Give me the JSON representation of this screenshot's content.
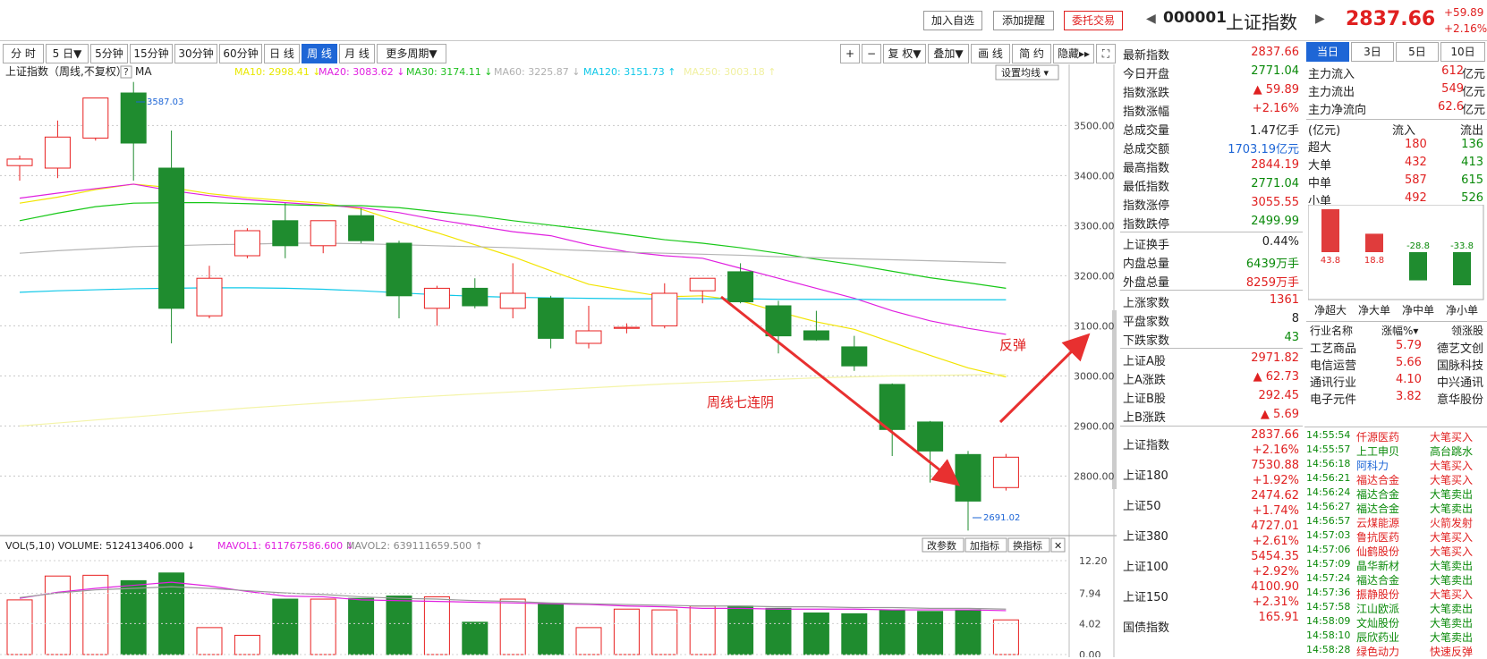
{
  "header": {
    "buttons": [
      "加入自选",
      "添加提醒",
      "委托交易"
    ],
    "code": "000001",
    "name": "上证指数",
    "price": "2837.66",
    "change": "+59.89",
    "change_pct": "+2.16%"
  },
  "periods": [
    "分 时",
    "5 日▼",
    "5分钟",
    "15分钟",
    "30分钟",
    "60分钟",
    "日 线",
    "周 线",
    "月 线",
    "更多周期▼"
  ],
  "tools": [
    "+",
    "−",
    "复 权▼",
    "叠加▼",
    "画 线",
    "简 约",
    "隐藏▸▸",
    "⛶"
  ],
  "chart": {
    "title": "上证指数（周线,不复权）",
    "q": "?",
    "ma_label": "MA",
    "ma_items": [
      {
        "text": "MA10: 2998.41 ↓",
        "color": "#e8e800"
      },
      {
        "text": "MA20: 3083.62 ↓",
        "color": "#e020e0"
      },
      {
        "text": "MA30: 3174.11 ↓",
        "color": "#20c020"
      },
      {
        "text": "MA60: 3225.87 ↓",
        "color": "#b0b0b0"
      },
      {
        "text": "MA120: 3151.73 ↑",
        "color": "#10c8e8"
      },
      {
        "text": "MA250: 3003.18 ↑",
        "color": "#f0f0a0"
      }
    ],
    "set_ma": "设置均线 ▾",
    "ytick_labels": [
      "3500.00",
      "3400.00",
      "3300.00",
      "3200.00",
      "3100.00",
      "3000.00",
      "2900.00",
      "2800.00"
    ],
    "high_label": "3587.03",
    "low_label": "2691.02",
    "annot1": "周线七连阴",
    "annot2": "反弹",
    "vol_title": "VOL(5,10)  VOLUME: 512413406.000 ↓",
    "vol_m1": "MAVOL1: 611767586.600 ↓",
    "vol_m2": "MAVOL2: 639111659.500 ↑",
    "vol_buttons": [
      "改参数",
      "加指标",
      "换指标",
      "✕"
    ],
    "vol_ticks": [
      "12.20",
      "7.94",
      "4.02",
      "0.00"
    ]
  },
  "chart_data": {
    "type": "candlestick",
    "ylim": [
      2690,
      3590
    ],
    "candles": [
      {
        "o": 3420,
        "h": 3440,
        "l": 3390,
        "c": 3433
      },
      {
        "o": 3415,
        "h": 3510,
        "l": 3395,
        "c": 3477
      },
      {
        "o": 3475,
        "h": 3550,
        "l": 3470,
        "c": 3555
      },
      {
        "o": 3565,
        "h": 3587.03,
        "l": 3390,
        "c": 3465
      },
      {
        "o": 3415,
        "h": 3490,
        "l": 3065,
        "c": 3135
      },
      {
        "o": 3120,
        "h": 3220,
        "l": 3115,
        "c": 3195
      },
      {
        "o": 3240,
        "h": 3295,
        "l": 3235,
        "c": 3290
      },
      {
        "o": 3310,
        "h": 3345,
        "l": 3235,
        "c": 3260
      },
      {
        "o": 3260,
        "h": 3310,
        "l": 3245,
        "c": 3310
      },
      {
        "o": 3320,
        "h": 3335,
        "l": 3265,
        "c": 3270
      },
      {
        "o": 3265,
        "h": 3270,
        "l": 3115,
        "c": 3160
      },
      {
        "o": 3135,
        "h": 3180,
        "l": 3100,
        "c": 3175
      },
      {
        "o": 3175,
        "h": 3195,
        "l": 3135,
        "c": 3140
      },
      {
        "o": 3135,
        "h": 3225,
        "l": 3115,
        "c": 3165
      },
      {
        "o": 3155,
        "h": 3160,
        "l": 3055,
        "c": 3075
      },
      {
        "o": 3065,
        "h": 3140,
        "l": 3055,
        "c": 3090
      },
      {
        "o": 3095,
        "h": 3105,
        "l": 3085,
        "c": 3097
      },
      {
        "o": 3100,
        "h": 3185,
        "l": 3095,
        "c": 3165
      },
      {
        "o": 3170,
        "h": 3190,
        "l": 3145,
        "c": 3195
      },
      {
        "o": 3208,
        "h": 3225,
        "l": 3145,
        "c": 3148
      },
      {
        "o": 3140,
        "h": 3150,
        "l": 3045,
        "c": 3080
      },
      {
        "o": 3090,
        "h": 3130,
        "l": 3070,
        "c": 3072
      },
      {
        "o": 3058,
        "h": 3080,
        "l": 3010,
        "c": 3020
      },
      {
        "o": 2983,
        "h": 2985,
        "l": 2840,
        "c": 2893
      },
      {
        "o": 2908,
        "h": 2910,
        "l": 2787,
        "c": 2850
      },
      {
        "o": 2843,
        "h": 2850,
        "l": 2691.02,
        "c": 2750
      },
      {
        "o": 2777,
        "h": 2844.19,
        "l": 2771.04,
        "c": 2837.66
      }
    ],
    "ma_series": [
      {
        "name": "MA10",
        "color": "#f2e400",
        "values": [
          3345,
          3357,
          3372,
          3383,
          3376,
          3364,
          3356,
          3350,
          3345,
          3333,
          3308,
          3286,
          3262,
          3238,
          3210,
          3183,
          3170,
          3158,
          3160,
          3150,
          3128,
          3108,
          3093,
          3067,
          3041,
          3016,
          2998
        ]
      },
      {
        "name": "MA20",
        "color": "#e020e0",
        "values": [
          3355,
          3365,
          3374,
          3383,
          3370,
          3360,
          3352,
          3346,
          3341,
          3336,
          3326,
          3312,
          3300,
          3288,
          3280,
          3262,
          3248,
          3240,
          3235,
          3215,
          3195,
          3175,
          3155,
          3130,
          3110,
          3095,
          3083
        ]
      },
      {
        "name": "MA30",
        "color": "#18c818",
        "values": [
          3310,
          3325,
          3338,
          3345,
          3346,
          3346,
          3344,
          3342,
          3340,
          3340,
          3336,
          3328,
          3320,
          3310,
          3301,
          3292,
          3282,
          3272,
          3265,
          3256,
          3245,
          3233,
          3222,
          3209,
          3196,
          3186,
          3175
        ]
      },
      {
        "name": "MA60",
        "color": "#b4b4b4",
        "values": [
          3245,
          3250,
          3254,
          3258,
          3260,
          3262,
          3263,
          3265,
          3265,
          3264,
          3262,
          3260,
          3258,
          3256,
          3253,
          3250,
          3247,
          3245,
          3243,
          3241,
          3238,
          3236,
          3234,
          3232,
          3230,
          3228,
          3226
        ]
      },
      {
        "name": "MA120",
        "color": "#10c8e8",
        "values": [
          3167,
          3170,
          3172,
          3174,
          3175,
          3176,
          3176,
          3175,
          3173,
          3170,
          3166,
          3162,
          3159,
          3157,
          3156,
          3155,
          3154,
          3154,
          3154,
          3154,
          3153,
          3153,
          3153,
          3152,
          3152,
          3152,
          3152
        ]
      },
      {
        "name": "MA250",
        "color": "#f4f4a8",
        "values": [
          2900,
          2906,
          2912,
          2918,
          2924,
          2930,
          2936,
          2941,
          2946,
          2951,
          2956,
          2960,
          2964,
          2968,
          2972,
          2976,
          2980,
          2984,
          2987,
          2990,
          2993,
          2996,
          2998,
          3000,
          3001,
          3002,
          3003
        ]
      }
    ],
    "volume": {
      "max": 12.2,
      "values": [
        7.1,
        10.2,
        10.3,
        9.6,
        10.6,
        3.5,
        2.5,
        7.2,
        7.2,
        7.3,
        7.6,
        7.5,
        4.2,
        7.2,
        6.6,
        3.5,
        5.9,
        5.8,
        6.3,
        6.3,
        6.0,
        5.4,
        5.3,
        5.8,
        5.6,
        5.8,
        4.5
      ],
      "mavol1": [
        7.3,
        8.1,
        8.6,
        9.0,
        9.4,
        8.9,
        8.2,
        7.6,
        7.5,
        7.1,
        7.0,
        6.9,
        6.8,
        6.7,
        6.6,
        6.5,
        6.3,
        6.2,
        6.0,
        6.0,
        5.9,
        5.9,
        5.9,
        5.8,
        5.8,
        5.8,
        5.7
      ],
      "mavol2": [
        7.4,
        8.0,
        8.4,
        8.6,
        8.8,
        8.6,
        8.3,
        8.0,
        7.8,
        7.5,
        7.3,
        7.2,
        7.0,
        6.9,
        6.7,
        6.6,
        6.5,
        6.4,
        6.3,
        6.3,
        6.2,
        6.2,
        6.1,
        6.1,
        6.0,
        6.0,
        5.9
      ]
    }
  },
  "quote_rows": [
    {
      "l": "最新指数",
      "v": "2837.66",
      "c": "red"
    },
    {
      "l": "今日开盘",
      "v": "2771.04",
      "c": "green"
    },
    {
      "l": "指数涨跌",
      "v": "▲ 59.89",
      "c": "red"
    },
    {
      "l": "指数涨幅",
      "v": "+2.16%",
      "c": "red"
    },
    {
      "l": "总成交量",
      "v": "1.47亿手",
      "c": "dark"
    },
    {
      "l": "总成交额",
      "v": "1703.19亿元",
      "c": "blue"
    },
    {
      "l": "最高指数",
      "v": "2844.19",
      "c": "red"
    },
    {
      "l": "最低指数",
      "v": "2771.04",
      "c": "green"
    },
    {
      "l": "指数涨停",
      "v": "3055.55",
      "c": "red"
    },
    {
      "l": "指数跌停",
      "v": "2499.99",
      "c": "green"
    },
    {
      "l": "上证换手",
      "v": "0.44%",
      "c": "dark"
    },
    {
      "l": "内盘总量",
      "v": "6439万手",
      "c": "green"
    },
    {
      "l": "外盘总量",
      "v": "8259万手",
      "c": "red"
    },
    {
      "l": "上涨家数",
      "v": "1361",
      "c": "red"
    },
    {
      "l": "平盘家数",
      "v": "8",
      "c": "dark"
    },
    {
      "l": "下跌家数",
      "v": "43",
      "c": "green"
    },
    {
      "l": "上证A股",
      "v": "2971.82",
      "c": "red"
    },
    {
      "l": "上A涨跌",
      "v": "▲ 62.73",
      "c": "red"
    },
    {
      "l": "上证B股",
      "v": "292.45",
      "c": "red"
    },
    {
      "l": "上B涨跌",
      "v": "▲ 5.69",
      "c": "red"
    }
  ],
  "indices": [
    {
      "name": "上证指数",
      "v": "2837.66",
      "p": "+2.16%"
    },
    {
      "name": "上证180",
      "v": "7530.88",
      "p": "+1.92%"
    },
    {
      "name": "上证50",
      "v": "2474.62",
      "p": "+1.74%"
    },
    {
      "name": "上证380",
      "v": "4727.01",
      "p": "+2.61%"
    },
    {
      "name": "上证100",
      "v": "5454.35",
      "p": "+2.92%"
    },
    {
      "name": "上证150",
      "v": "4100.90",
      "p": "+2.31%"
    },
    {
      "name": "国债指数",
      "v": "165.91",
      "p": ""
    }
  ],
  "flow": {
    "tabs": [
      "当日",
      "3日",
      "5日",
      "10日"
    ],
    "main": [
      {
        "l": "主力流入",
        "v": "612",
        "u": "亿元"
      },
      {
        "l": "主力流出",
        "v": "549",
        "u": "亿元"
      },
      {
        "l": "主力净流向",
        "v": "62.6",
        "u": "亿元"
      }
    ],
    "head": [
      "(亿元)",
      "流入",
      "流出"
    ],
    "rows": [
      {
        "l": "超大",
        "i": "180",
        "o": "136"
      },
      {
        "l": "大单",
        "i": "432",
        "o": "413"
      },
      {
        "l": "中单",
        "i": "587",
        "o": "615"
      },
      {
        "l": "小单",
        "i": "492",
        "o": "526"
      }
    ],
    "net": [
      {
        "l": "净超大",
        "v": 43.8,
        "t": "43.8"
      },
      {
        "l": "净大单",
        "v": 18.8,
        "t": "18.8"
      },
      {
        "l": "净中单",
        "v": -28.8,
        "t": "-28.8"
      },
      {
        "l": "净小单",
        "v": -33.8,
        "t": "-33.8"
      }
    ],
    "sector_head": [
      "行业名称",
      "涨幅%▾",
      "领涨股"
    ],
    "sectors": [
      {
        "n": "工艺商品",
        "p": "5.79",
        "s": "德艺文创"
      },
      {
        "n": "电信运营",
        "p": "5.66",
        "s": "国脉科技"
      },
      {
        "n": "通讯行业",
        "p": "4.10",
        "s": "中兴通讯"
      },
      {
        "n": "电子元件",
        "p": "3.82",
        "s": "意华股份"
      }
    ]
  },
  "trades": [
    {
      "t": "14:55:54",
      "n": "仟源医药",
      "a": "大笔买入",
      "ac": "red",
      "nc": "red"
    },
    {
      "t": "14:55:57",
      "n": "上工申贝",
      "a": "高台跳水",
      "ac": "green",
      "nc": "green"
    },
    {
      "t": "14:56:18",
      "n": "阿科力",
      "a": "大笔买入",
      "ac": "red",
      "nc": "blue"
    },
    {
      "t": "14:56:21",
      "n": "福达合金",
      "a": "大笔买入",
      "ac": "red",
      "nc": "red"
    },
    {
      "t": "14:56:24",
      "n": "福达合金",
      "a": "大笔卖出",
      "ac": "green",
      "nc": "green"
    },
    {
      "t": "14:56:27",
      "n": "福达合金",
      "a": "大笔卖出",
      "ac": "green",
      "nc": "green"
    },
    {
      "t": "14:56:57",
      "n": "云煤能源",
      "a": "火箭发射",
      "ac": "red",
      "nc": "red"
    },
    {
      "t": "14:57:03",
      "n": "鲁抗医药",
      "a": "大笔买入",
      "ac": "red",
      "nc": "red"
    },
    {
      "t": "14:57:06",
      "n": "仙鹤股份",
      "a": "大笔买入",
      "ac": "red",
      "nc": "red"
    },
    {
      "t": "14:57:09",
      "n": "晶华新材",
      "a": "大笔卖出",
      "ac": "green",
      "nc": "green"
    },
    {
      "t": "14:57:24",
      "n": "福达合金",
      "a": "大笔卖出",
      "ac": "green",
      "nc": "green"
    },
    {
      "t": "14:57:36",
      "n": "振静股份",
      "a": "大笔买入",
      "ac": "red",
      "nc": "red"
    },
    {
      "t": "14:57:58",
      "n": "江山欧派",
      "a": "大笔卖出",
      "ac": "green",
      "nc": "green"
    },
    {
      "t": "14:58:09",
      "n": "文灿股份",
      "a": "大笔卖出",
      "ac": "green",
      "nc": "green"
    },
    {
      "t": "14:58:10",
      "n": "辰欣药业",
      "a": "大笔卖出",
      "ac": "green",
      "nc": "green"
    },
    {
      "t": "14:58:28",
      "n": "绿色动力",
      "a": "快速反弹",
      "ac": "red",
      "nc": "red"
    }
  ]
}
